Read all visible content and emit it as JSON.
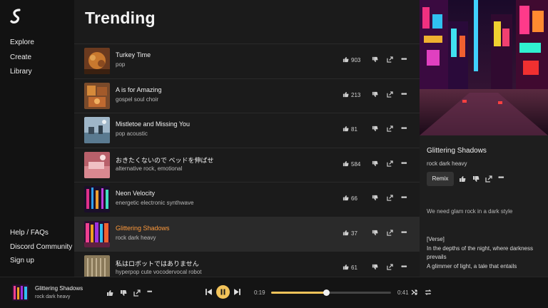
{
  "sidebar": {
    "nav": [
      {
        "label": "Explore"
      },
      {
        "label": "Create"
      },
      {
        "label": "Library"
      }
    ],
    "footer": [
      {
        "label": "Help / FAQs"
      },
      {
        "label": "Discord Community"
      },
      {
        "label": "Sign up"
      }
    ]
  },
  "main": {
    "title": "Trending",
    "songs": [
      {
        "title": "Turkey Time",
        "tags": "pop",
        "likes": "903"
      },
      {
        "title": "A is for Amazing",
        "tags": "gospel soul choir",
        "likes": "213"
      },
      {
        "title": "Mistletoe and Missing You",
        "tags": "pop acoustic",
        "likes": "81"
      },
      {
        "title": "おきたくないので ベッドを伸ばせ",
        "tags": "alternative rock, emotional",
        "likes": "584"
      },
      {
        "title": "Neon Velocity",
        "tags": "energetic electronic synthwave",
        "likes": "66"
      },
      {
        "title": "Glittering Shadows",
        "tags": "rock dark heavy",
        "likes": "37"
      },
      {
        "title": "私はロボットではありません",
        "tags": "hyperpop cute vocodervocal robot",
        "likes": "61"
      }
    ]
  },
  "detail": {
    "title": "Glittering Shadows",
    "tags": "rock dark heavy",
    "remix_label": "Remix",
    "description": "We need glam rock in a dark style",
    "lyrics": [
      "[Verse]",
      "In the depths of the night, where darkness prevails",
      "A glimmer of light, a tale that entails"
    ]
  },
  "player": {
    "title": "Glittering Shadows",
    "tags": "rock dark heavy",
    "current_time": "0:19",
    "total_time": "0:41",
    "progress": 0.46
  },
  "colors": {
    "accent": "#f2c35a",
    "active_title": "#ff9a3c"
  }
}
